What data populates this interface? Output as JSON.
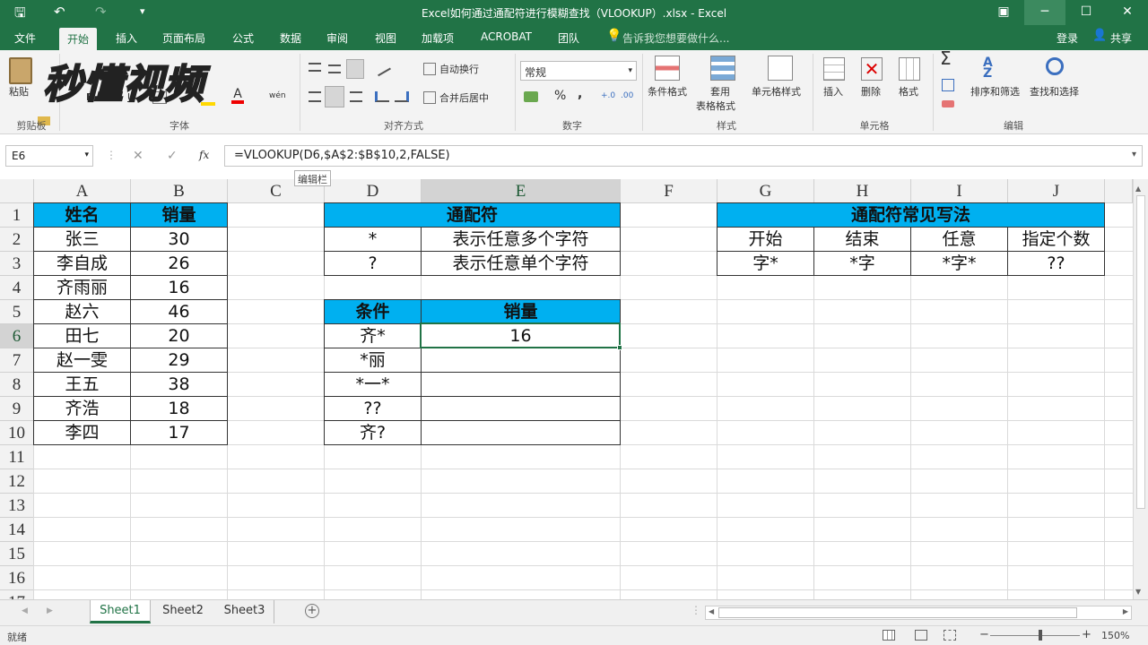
{
  "app": {
    "title": "Excel如何通过通配符进行模糊查找（VLOOKUP）.xlsx - Excel",
    "save_icon": "save-icon",
    "undo_icon": "undo-icon",
    "redo_icon": "redo-icon",
    "customize_icon": "customize-qat-icon"
  },
  "window": {
    "ribbon_display": "▣",
    "minimize": "─",
    "restore": "☐",
    "close": "✕"
  },
  "tabs": [
    "文件",
    "开始",
    "插入",
    "页面布局",
    "公式",
    "数据",
    "审阅",
    "视图",
    "加载项",
    "ACROBAT",
    "团队"
  ],
  "tellme": "告诉我您想要做什么...",
  "login": "登录",
  "share": "共享",
  "watermark": "秒懂视频",
  "ribbon": {
    "clipboard": {
      "paste": "粘贴",
      "label": "剪贴板"
    },
    "font": {
      "bold": "B",
      "italic": "I",
      "underline": "U",
      "label": "字体",
      "wen": "wén"
    },
    "alignment": {
      "wrap": "自动换行",
      "merge": "合并后居中",
      "label": "对齐方式"
    },
    "number": {
      "format": "常规",
      "percent": "%",
      "comma": ",",
      "label": "数字"
    },
    "styles": {
      "conditional": "条件格式",
      "table": "套用",
      "table2": "表格格式",
      "cell_styles": "单元格样式",
      "label": "样式"
    },
    "cells": {
      "insert": "插入",
      "delete": "删除",
      "format": "格式",
      "label": "单元格"
    },
    "editing": {
      "sum": "Σ",
      "sort": "排序和筛选",
      "find": "查找和选择",
      "label": "编辑"
    }
  },
  "formula_bar": {
    "name_box": "E6",
    "cancel": "✕",
    "enter": "✓",
    "fx": "fx",
    "formula": "=VLOOKUP(D6,$A$2:$B$10,2,FALSE)",
    "tooltip": "编辑栏"
  },
  "columns": [
    "A",
    "B",
    "C",
    "D",
    "E",
    "F",
    "G",
    "H",
    "I",
    "J"
  ],
  "rows": [
    "1",
    "2",
    "3",
    "4",
    "5",
    "6",
    "7",
    "8",
    "9",
    "10",
    "11",
    "12",
    "13",
    "14",
    "15",
    "16",
    "17"
  ],
  "active_cell": "E6",
  "cells": {
    "A1": "姓名",
    "B1": "销量",
    "A2": "张三",
    "B2": "30",
    "A3": "李自成",
    "B3": "26",
    "A4": "齐雨丽",
    "B4": "16",
    "A5": "赵六",
    "B5": "46",
    "A6": "田七",
    "B6": "20",
    "A7": "赵一雯",
    "B7": "29",
    "A8": "王五",
    "B8": "38",
    "A9": "齐浩",
    "B9": "18",
    "A10": "李四",
    "B10": "17",
    "D1": "通配符",
    "D2": "*",
    "E2": "表示任意多个字符",
    "D3": "?",
    "E3": "表示任意单个字符",
    "D5": "条件",
    "E5": "销量",
    "D6": "齐*",
    "E6": "16",
    "D7": "*丽",
    "D8": "*一*",
    "D9": "??",
    "D10": "齐?",
    "G1": "通配符常见写法",
    "G2": "开始",
    "H2": "结束",
    "I2": "任意",
    "J2": "指定个数",
    "G3": "字*",
    "H3": "*字",
    "I3": "*字*",
    "J3": "??"
  },
  "sheets": [
    "Sheet1",
    "Sheet2",
    "Sheet3"
  ],
  "active_sheet": "Sheet1",
  "status": {
    "ready": "就绪",
    "zoom": "150%",
    "zoom_minus": "−",
    "zoom_plus": "+"
  }
}
